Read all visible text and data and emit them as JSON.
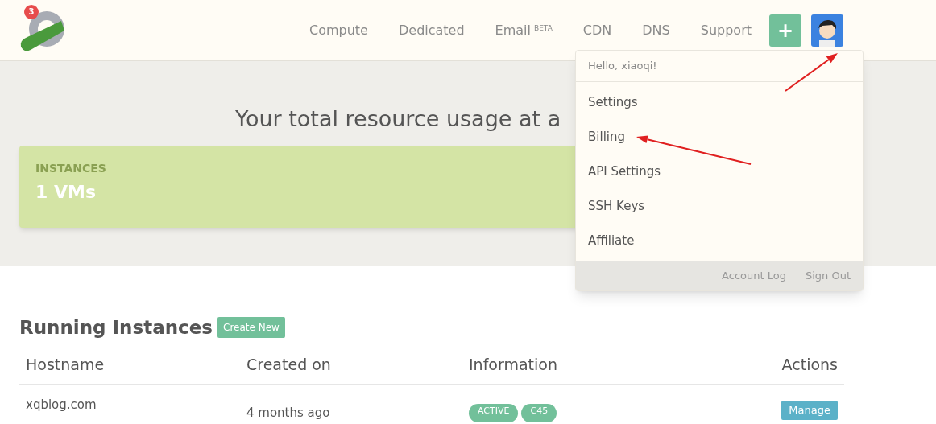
{
  "logo": {
    "badge": "3"
  },
  "nav": [
    {
      "label": "Compute"
    },
    {
      "label": "Dedicated"
    },
    {
      "label": "Email",
      "sup": "BETA"
    },
    {
      "label": "CDN"
    },
    {
      "label": "DNS"
    },
    {
      "label": "Support"
    }
  ],
  "add_button": "+",
  "user_menu": {
    "expanded": true,
    "greeting": "Hello, xiaoqi!",
    "items": [
      {
        "label": "Settings"
      },
      {
        "label": "Billing"
      },
      {
        "label": "API Settings"
      },
      {
        "label": "SSH Keys"
      },
      {
        "label": "Affiliate"
      }
    ],
    "footer": [
      "Account Log",
      "Sign Out"
    ]
  },
  "hero": {
    "title": "Your total resource usage at a",
    "card": {
      "label": "INSTANCES",
      "value": "1 VMs"
    }
  },
  "instances": {
    "title": "Running Instances",
    "create_button": "Create New",
    "columns": [
      "Hostname",
      "Created on",
      "Information",
      "Actions"
    ],
    "rows": [
      {
        "hostname": "xqblog.com",
        "created": "4 months ago",
        "tags": [
          "ACTIVE",
          "C45"
        ],
        "action": "Manage"
      }
    ]
  },
  "annotations": [
    {
      "kind": "arrow"
    },
    {
      "kind": "arrow"
    }
  ]
}
